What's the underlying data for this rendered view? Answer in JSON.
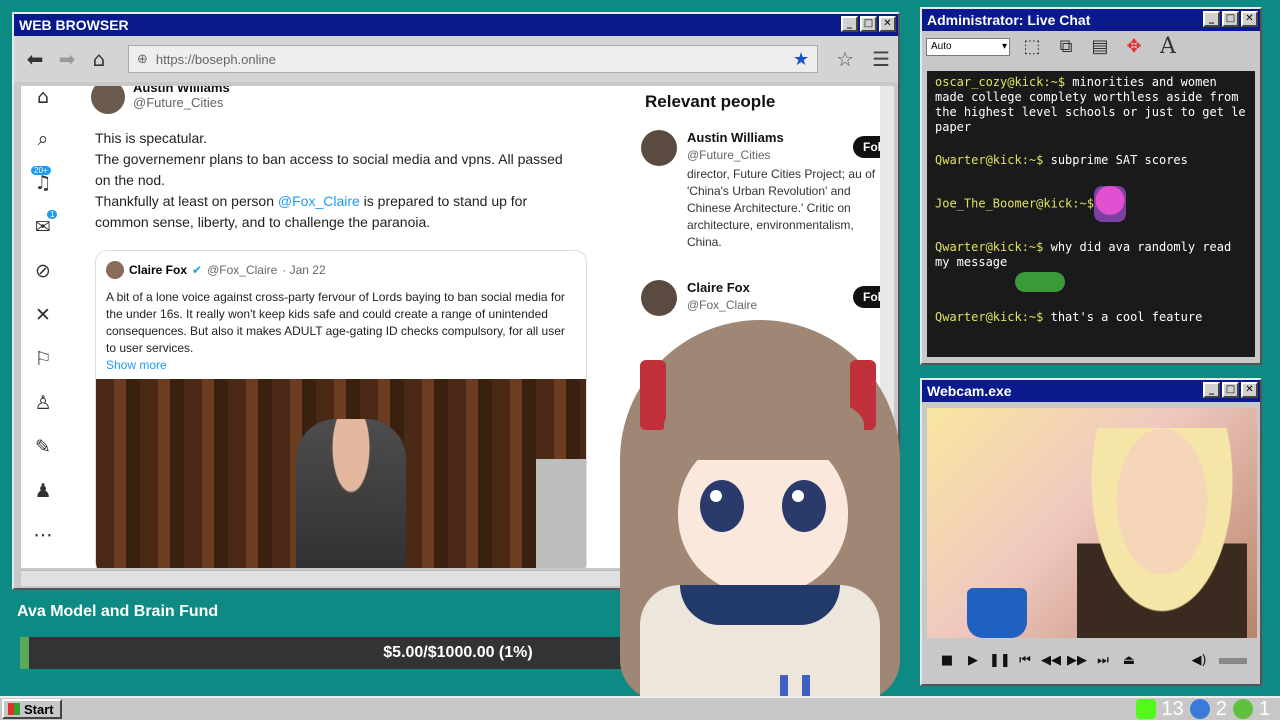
{
  "browser": {
    "title": "WEB BROWSER",
    "url": "https://boseph.online",
    "controls": {
      "minimize": "_",
      "maximize": "□",
      "close": "✕"
    }
  },
  "leftnav": {
    "badge_notifications": "20+",
    "badge_messages": "1"
  },
  "tweet": {
    "author_name": "Austin Williams",
    "author_handle": "@Future_Cities",
    "line1": "This is specatular.",
    "line2": "The governemenr plans to ban access to social media and vpns. All passed on the nod.",
    "line3_prefix": "Thankfully at least on person ",
    "line3_link": "@Fox_Claire",
    "line3_suffix": " is prepared to stand up for common sense, liberty, and to challenge the paranoia.",
    "quote": {
      "name": "Claire Fox",
      "handle": "@Fox_Claire",
      "date": "· Jan 22",
      "text": "A bit of a lone voice against cross-party fervour of Lords baying to ban social media for the under 16s. It really won't keep kids safe and could create a range of unintended consequences. But also it makes ADULT age-gating ID checks compulsory, for all user to user services.",
      "show_more": "Show more"
    }
  },
  "relevant": {
    "title": "Relevant people",
    "people": [
      {
        "name": "Austin Williams",
        "handle": "@Future_Cities",
        "bio": "director, Future Cities Project; au of 'China's Urban Revolution' and Chinese Architecture.' Critic on architecture, environmentalism, China.",
        "follow": "Follow"
      },
      {
        "name": "Claire Fox",
        "handle": "@Fox_Claire",
        "bio": "",
        "follow": "Follow"
      }
    ]
  },
  "fund": {
    "title": "Ava Model and Brain Fund",
    "text": "$5.00/$1000.00 (1%)",
    "percent": 1
  },
  "chat": {
    "title": "Administrator: Live Chat",
    "font_select": "Auto",
    "messages": [
      {
        "user": "oscar_cozy@kick:~$",
        "text": " minorities and women made college complety worthless aside from the highest level schools or just to get le paper"
      },
      {
        "user": "Qwarter@kick:~$",
        "text": " subprime SAT scores"
      },
      {
        "user": "Joe_The_Boomer@kick:~$",
        "text": ""
      },
      {
        "user": "Qwarter@kick:~$",
        "text": " why did ava randomly read my message"
      },
      {
        "user": "Qwarter@kick:~$",
        "text": " that's a cool feature"
      }
    ]
  },
  "webcam": {
    "title": "Webcam.exe"
  },
  "taskbar": {
    "start": "Start",
    "tray_count_1": "13",
    "tray_count_2": "2",
    "tray_count_3": "1"
  },
  "colors": {
    "desktop": "#0e8a84",
    "titlebar": "#0a1a8c",
    "link": "#1d9bf0"
  }
}
